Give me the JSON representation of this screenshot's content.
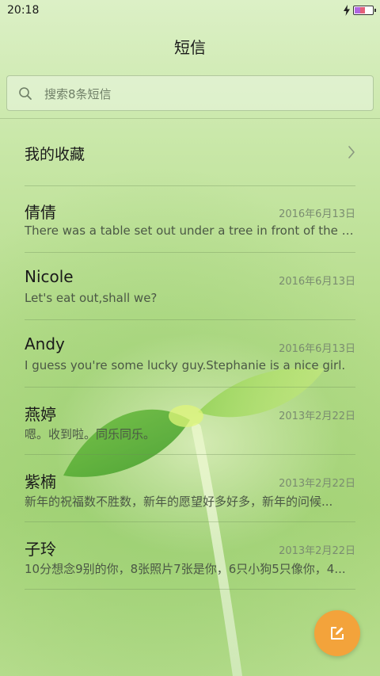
{
  "status_bar": {
    "time": "20:18"
  },
  "header": {
    "title": "短信"
  },
  "search": {
    "placeholder": "搜索8条短信",
    "value": ""
  },
  "favorites": {
    "label": "我的收藏"
  },
  "threads": [
    {
      "name": "倩倩",
      "date": "2016年6月13日",
      "preview": "There was a table set out under a tree in front of the ho..."
    },
    {
      "name": "Nicole",
      "date": "2016年6月13日",
      "preview": "Let's eat out,shall we?"
    },
    {
      "name": "Andy",
      "date": "2016年6月13日",
      "preview": "I guess you're some lucky guy.Stephanie is a nice girl."
    },
    {
      "name": "燕婷",
      "date": "2013年2月22日",
      "preview": "嗯。收到啦。同乐同乐。"
    },
    {
      "name": "紫楠",
      "date": "2013年2月22日",
      "preview": "新年的祝福数不胜数，新年的愿望好多好多，新年的问候..."
    },
    {
      "name": "子玲",
      "date": "2013年2月22日",
      "preview": "10分想念9别的你，8张照片7张是你，6只小狗5只像你，4..."
    }
  ],
  "icons": {
    "status_charging": "bolt-icon",
    "status_battery": "battery-icon",
    "search": "search-icon",
    "favorites_arrow": "chevron-right-icon",
    "compose": "compose-icon"
  },
  "colors": {
    "compose_button": "#f3a33b",
    "background_green": "#b5dc8a"
  }
}
